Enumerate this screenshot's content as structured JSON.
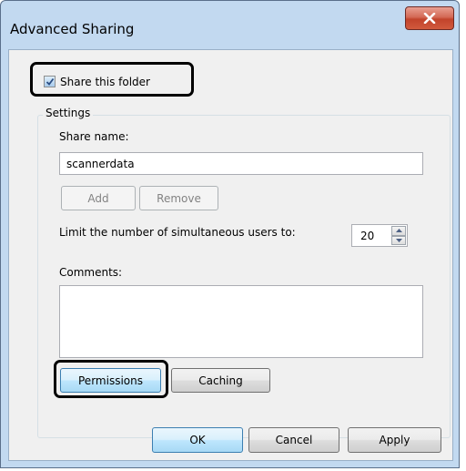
{
  "window": {
    "title": "Advanced Sharing",
    "close_icon": "close-icon"
  },
  "share_folder": {
    "label": "Share this folder",
    "checked": true
  },
  "settings": {
    "group_label": "Settings",
    "share_name_label": "Share name:",
    "share_name_value": "scannerdata",
    "add_label": "Add",
    "remove_label": "Remove",
    "limit_label": "Limit the number of simultaneous users to:",
    "limit_value": "20",
    "comments_label": "Comments:",
    "comments_value": "",
    "permissions_label": "Permissions",
    "caching_label": "Caching"
  },
  "footer": {
    "ok_label": "OK",
    "cancel_label": "Cancel",
    "apply_label": "Apply"
  },
  "colors": {
    "title_bar": "#c2d9f0",
    "close_button": "#c2432b",
    "client_bg": "#f0f0f0",
    "focused_button": "#bee6fd"
  }
}
